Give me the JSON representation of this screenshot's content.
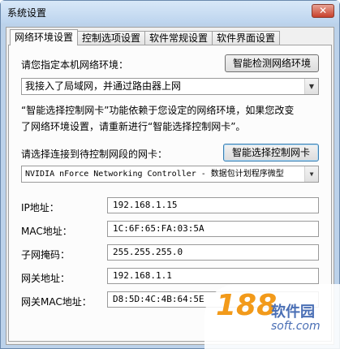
{
  "window": {
    "title": "系统设置",
    "close_label": "✕"
  },
  "tabs": [
    {
      "label": "网络环境设置"
    },
    {
      "label": "控制选项设置"
    },
    {
      "label": "软件常规设置"
    },
    {
      "label": "软件界面设置"
    }
  ],
  "network": {
    "prompt": "请您指定本机网络环境：",
    "detect_button": "智能检测网络环境",
    "environment_value": "我接入了局域网，并通过路由器上网",
    "note_line1": "“智能选择控制网卡”功能依赖于您设定的网络环境，如果您改变",
    "note_line2": "了网络环境设置，请重新进行“智能选择控制网卡”。",
    "nic_prompt": "请选择连接到待控制网段的网卡：",
    "nic_button": "智能选择控制网卡",
    "nic_value": "NVIDIA nForce Networking Controller - 数据包计划程序微型"
  },
  "fields": [
    {
      "label": "IP地址：",
      "value": "192.168.1.15"
    },
    {
      "label": "MAC地址：",
      "value": "1C:6F:65:FA:03:5A"
    },
    {
      "label": "子网掩码：",
      "value": "255.255.255.0"
    },
    {
      "label": "网关地址：",
      "value": "192.168.1.1"
    },
    {
      "label": "网关MAC地址：",
      "value": "D8:5D:4C:4B:64:5E"
    }
  ],
  "watermark": {
    "number": "188",
    "name": "软件园",
    "url": "soft.com"
  },
  "colors": {
    "frame": "#bcd2ea",
    "close": "#c7402b",
    "watermark_orange": "#f29a1a",
    "watermark_blue": "#4a6fb5"
  }
}
